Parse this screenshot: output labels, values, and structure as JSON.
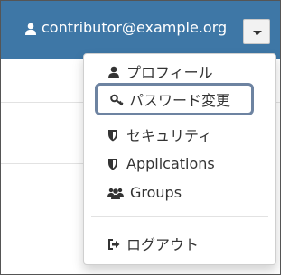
{
  "header": {
    "user_email": "contributor@example.org"
  },
  "menu": {
    "items": [
      {
        "label": "プロフィール",
        "icon": "user-icon"
      },
      {
        "label": "パスワード変更",
        "icon": "key-icon"
      },
      {
        "label": "セキュリティ",
        "icon": "shield-icon"
      },
      {
        "label": "Applications",
        "icon": "shield-icon"
      },
      {
        "label": "Groups",
        "icon": "users-icon"
      },
      {
        "label": "ログアウト",
        "icon": "sign-out-icon"
      }
    ]
  },
  "colors": {
    "header_bg": "#3e77a6",
    "highlight_border": "#6d83a1"
  }
}
